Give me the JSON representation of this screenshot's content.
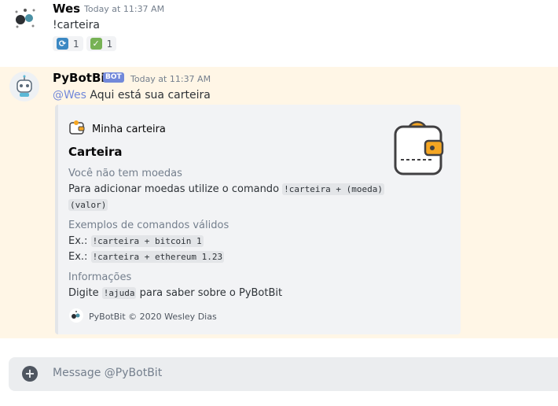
{
  "user_message": {
    "author": "Wes",
    "time": "Today at 11:37 AM",
    "text": "!carteira",
    "reactions": [
      {
        "icon": "repeat-icon",
        "count": "1",
        "color": "#3b88c3"
      },
      {
        "icon": "check-mark-icon",
        "count": "1",
        "color": "#77b255"
      }
    ]
  },
  "bot_message": {
    "author": "PyBotBit",
    "bot_tag": "BOT",
    "time": "Today at 11:37 AM",
    "mention": "@Wes",
    "text": " Aqui está sua carteira",
    "highlight_color": "#fff6e6"
  },
  "embed": {
    "author": "Minha carteira",
    "title": "Carteira",
    "fields": [
      {
        "name": "Você não tem moedas",
        "line1_prefix": "Para adicionar moedas utilize o comando ",
        "line1_code": "!carteira + (moeda)",
        "line2_code": "(valor)"
      },
      {
        "name": "Exemplos de comandos válidos",
        "ex1_prefix": "Ex.: ",
        "ex1_code": "!carteira + bitcoin 1",
        "ex2_prefix": "Ex.: ",
        "ex2_code": "!carteira + ethereum 1.23"
      },
      {
        "name": "Informações",
        "prefix": "Digite ",
        "code": "!ajuda",
        "suffix": " para saber sobre o PyBotBit"
      }
    ],
    "footer": "PyBotBit © 2020 Wesley Dias"
  },
  "input": {
    "placeholder": "Message @PyBotBit"
  }
}
